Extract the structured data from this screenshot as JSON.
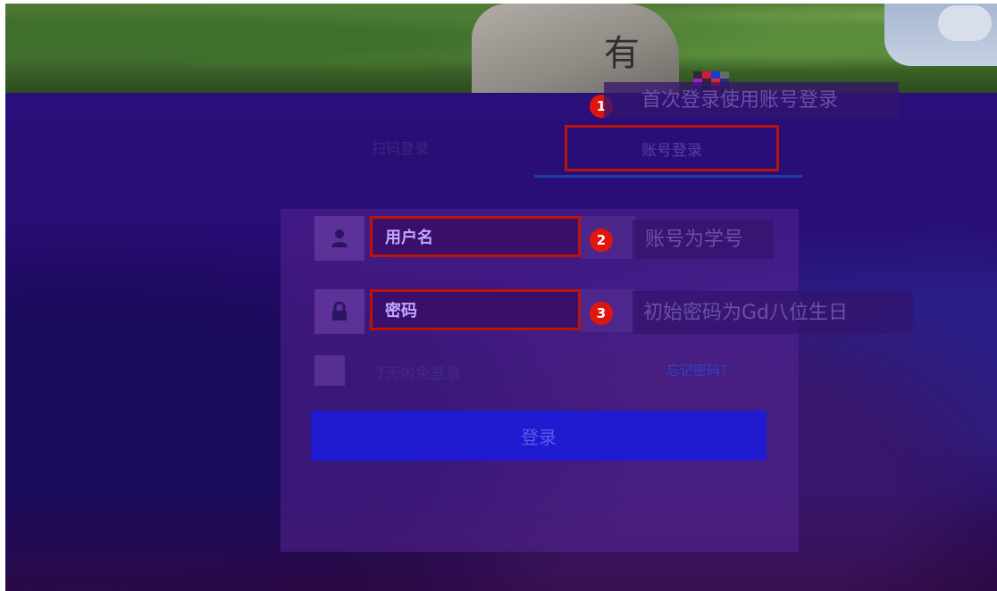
{
  "photo": {
    "stone_char": "有"
  },
  "tabs": {
    "left_label": "扫码登录",
    "right_label": "账号登录"
  },
  "callouts": [
    {
      "number": "1",
      "text": "首次登录使用账号登录"
    },
    {
      "number": "2",
      "text": "账号为学号"
    },
    {
      "number": "3",
      "text": "初始密码为Gd八位生日"
    }
  ],
  "form": {
    "username_placeholder": "用户名",
    "password_placeholder": "密码",
    "remember_label": "7天内免登录",
    "forgot_label": "忘记密码？",
    "login_button": "登录"
  },
  "colors": {
    "accent_red": "#e0160e",
    "button_blue": "#1f1bd0",
    "overlay": "#2a0f7a"
  },
  "icons": {
    "username": "user-icon",
    "password": "lock-icon"
  }
}
